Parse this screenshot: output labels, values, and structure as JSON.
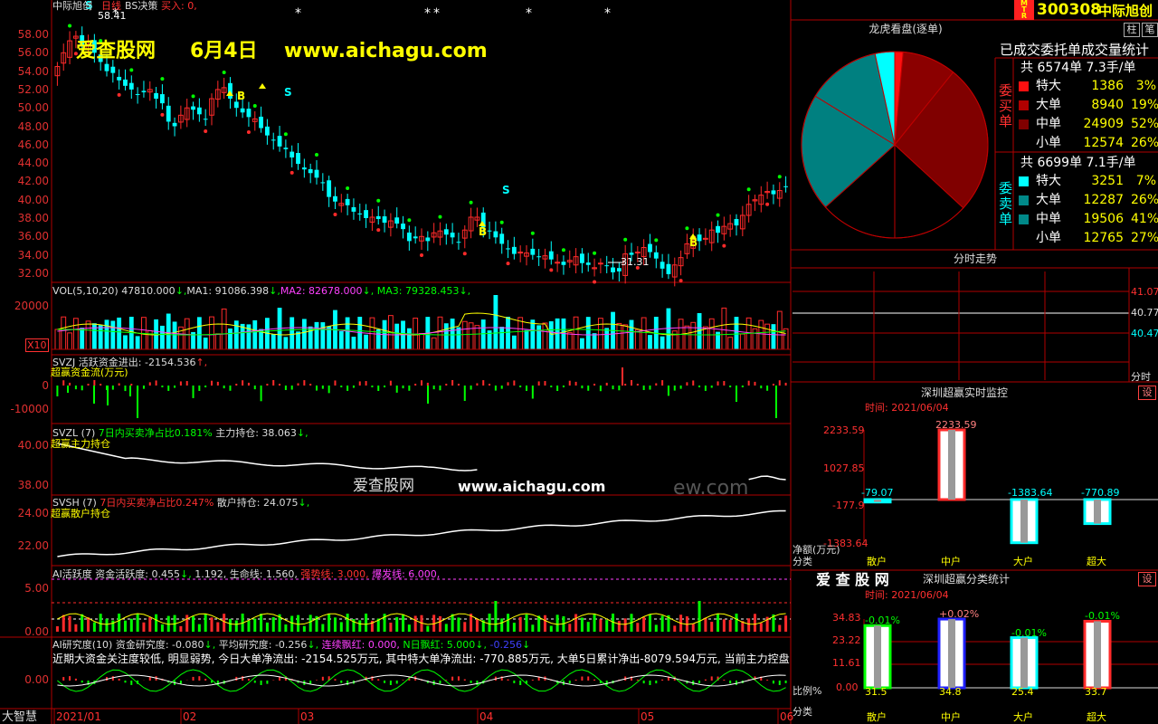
{
  "colors": {
    "up": "#ff2a2a",
    "down": "#00ffff",
    "grid": "#b00000",
    "white": "#ffffff",
    "yellow": "#ffff00",
    "magenta": "#ff40ff",
    "green": "#00ff00",
    "teal": "#008888",
    "darkred": "#800000"
  },
  "header": {
    "stock_label": "中际旭创",
    "period": "日线",
    "strategy": "BS决策",
    "buy_signal": "买入: 0,",
    "high_marker": "58.41",
    "low_marker": "31.31"
  },
  "watermark": {
    "site": "爱查股网",
    "date": "6月4日",
    "url": "www.aichagu.com"
  },
  "watermark2": {
    "text_a": "爱查股网",
    "url": "www.aichagu.com",
    "faint": "ew.com"
  },
  "bs_signals": {
    "s": "S",
    "b": "B"
  },
  "main_yaxis": [
    "58.00",
    "56.00",
    "54.00",
    "52.00",
    "50.00",
    "48.00",
    "46.00",
    "44.00",
    "42.00",
    "40.00",
    "38.00",
    "36.00",
    "34.00",
    "32.00"
  ],
  "vol_panel": {
    "label": "VOL(5,10,20)",
    "v1": "47810.000",
    "ma1": "MA1: 91086.398",
    "ma2": "MA2: 82678.000",
    "ma3": "MA3: 79328.453",
    "arrow": "↓,",
    "y1": "20000",
    "unit": "X10"
  },
  "svzj_panel": {
    "name": "SVZJ",
    "t1": "活跃资金进出: -2154.536",
    "t2": "↑,",
    "t3": "超赢资金流(万元)",
    "y1": "0",
    "y2": "-10000"
  },
  "svzl_panel": {
    "name": "SVZL (7)",
    "t1": "7日内买卖净占比0.181%",
    "t2": "主力持仓: 38.063",
    "t3": "↓,",
    "t4": "超赢主力持仓",
    "y1": "40.00",
    "y2": "38.00"
  },
  "svsh_panel": {
    "name": "SVSH (7)",
    "t1": "7日内买卖净占比0.247%",
    "t2": "散户持仓: 24.075",
    "t3": "↓,",
    "t4": "超赢散户持仓",
    "y1": "24.00",
    "y2": "22.00"
  },
  "ai_panel": {
    "name": "AI活跃度",
    "t1": "资金活跃度: 0.455",
    "t2": "↓,",
    "t3": "1.192,",
    "t4": "生命线: 1.560,",
    "t5": "强势线: 3.000,",
    "t6": "爆发线: 6.000,",
    "y1": "5.00",
    "y2": "0.00"
  },
  "ai2_panel": {
    "name": "AI研究度(10)",
    "t1": "资金研究度: -0.080",
    "t2": "↓,",
    "t3": "平均研究度: -0.256",
    "t4": "↓,",
    "t5": "连续飘红: 0.000,",
    "t6": "N日飘红: 5.000",
    "t7": "↓,",
    "t8": "-0.256",
    "t9": "↓",
    "desc": "近期大资金关注度较低, 明显弱势, 今日大单净流出: -2154.525万元, 其中特大单净流出: -770.885万元, 大单5日累计净出-8079.594万元, 当前主力控盘",
    "y1": "0.00"
  },
  "xaxis": {
    "corner": "大智慧",
    "labels": [
      "2021/01",
      "02",
      "03",
      "04",
      "05",
      "06"
    ]
  },
  "right_header": {
    "mtr": "MTR",
    "code": "300308",
    "name": "中际旭创",
    "btn1": "柱",
    "btn2": "笔"
  },
  "dragon": {
    "title": "龙虎看盘(逐单)",
    "subtitle": "已成交委托单成交量统计",
    "buy_label": "委买单",
    "sell_label": "委卖单",
    "buy_total": "共 6574单 7.3手/单",
    "sell_total": "共 6699单 7.1手/单",
    "buy_rows": [
      {
        "label": "特大",
        "value": "1386",
        "pct": "3%",
        "color": "#ff1010"
      },
      {
        "label": "大单",
        "value": "8940",
        "pct": "19%",
        "color": "#b00000"
      },
      {
        "label": "中单",
        "value": "24909",
        "pct": "52%",
        "color": "#800000"
      },
      {
        "label": "小单",
        "value": "12574",
        "pct": "26%",
        "color": "#000000"
      }
    ],
    "sell_rows": [
      {
        "label": "特大",
        "value": "3251",
        "pct": "7%",
        "color": "#00ffff"
      },
      {
        "label": "大单",
        "value": "12287",
        "pct": "26%",
        "color": "#008888"
      },
      {
        "label": "中单",
        "value": "19506",
        "pct": "41%",
        "color": "#008888"
      },
      {
        "label": "小单",
        "value": "12765",
        "pct": "27%",
        "color": "#000000"
      }
    ]
  },
  "intraday": {
    "title": "分时走势",
    "y1": "41.07",
    "y2": "40.77",
    "y3": "40.47",
    "label": "分时"
  },
  "monitor": {
    "title": "深圳超赢实时监控",
    "btn": "设",
    "time": "时间: 2021/06/04",
    "y1": "2233.59",
    "y2": "1027.85",
    "y3": "-177.9",
    "y4": "-1383.64",
    "ylabel": "净额(万元)",
    "xlabel": "分类",
    "cats": [
      "散户",
      "中户",
      "大户",
      "超大"
    ],
    "values": [
      "-79.07",
      "2233.59",
      "-1383.64",
      "-770.89"
    ]
  },
  "classify": {
    "brand": "爱 查 股 网",
    "title": "深圳超赢分类统计",
    "btn": "设",
    "time": "时间: 2021/06/04",
    "y1": "34.83",
    "y2": "23.22",
    "y3": "11.61",
    "y4": "0.00",
    "ylabel": "比例%",
    "xlabel": "分类",
    "cats": [
      "散户",
      "中户",
      "大户",
      "超大"
    ],
    "changes": [
      "-0.01%",
      "+0.02%",
      "-0.01%",
      "-0.01%"
    ],
    "values": [
      "31.5",
      "34.8",
      "25.4",
      "33.7"
    ]
  }
}
